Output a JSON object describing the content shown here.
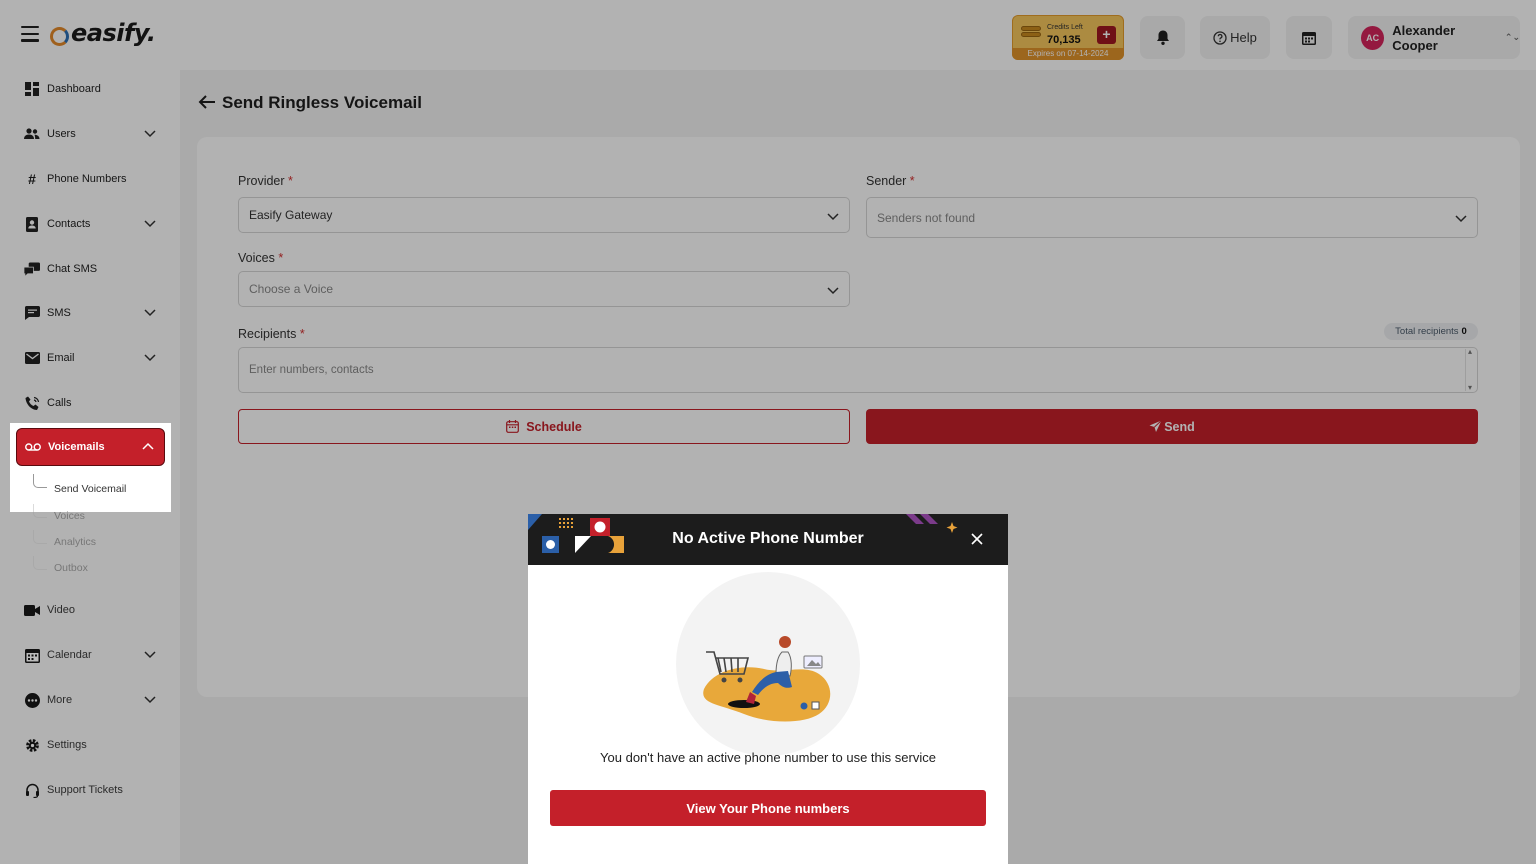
{
  "header": {
    "logo_text": "easify.",
    "credits": {
      "label": "Credits Left",
      "value": "70,135",
      "expires": "Expires on 07-14-2024",
      "plus": "+"
    },
    "help_label": "Help",
    "user": {
      "initials": "AC",
      "name": "Alexander Cooper",
      "caret": "⌃⌄"
    }
  },
  "sidebar": {
    "items": [
      {
        "label": "Dashboard",
        "icon": "dashboard-icon"
      },
      {
        "label": "Users",
        "icon": "users-icon"
      },
      {
        "label": "Phone Numbers",
        "icon": "hash-icon"
      },
      {
        "label": "Contacts",
        "icon": "contacts-icon"
      },
      {
        "label": "Chat SMS",
        "icon": "chat-icon"
      },
      {
        "label": "SMS",
        "icon": "sms-icon"
      },
      {
        "label": "Email",
        "icon": "mail-icon"
      },
      {
        "label": "Calls",
        "icon": "phone-icon"
      },
      {
        "label": "Voicemails",
        "icon": "voicemail-icon"
      },
      {
        "label": "Video",
        "icon": "video-icon"
      },
      {
        "label": "Calendar",
        "icon": "calendar-icon"
      },
      {
        "label": "More",
        "icon": "more-icon"
      },
      {
        "label": "Settings",
        "icon": "gear-icon"
      },
      {
        "label": "Support Tickets",
        "icon": "headset-icon"
      }
    ],
    "voicemail_sub": [
      "Send Voicemail",
      "Voices",
      "Analytics",
      "Outbox"
    ]
  },
  "page": {
    "title": "Send Ringless Voicemail",
    "provider_label": "Provider",
    "provider_value": "Easify Gateway",
    "sender_label": "Sender",
    "sender_placeholder": "Senders not found",
    "voices_label": "Voices",
    "voices_placeholder": "Choose a Voice",
    "recipients_label": "Recipients",
    "recipients_placeholder": "Enter numbers, contacts",
    "total_label": "Total recipients",
    "total_value": "0",
    "schedule_label": "Schedule",
    "send_label": "Send",
    "required_mark": "*"
  },
  "modal": {
    "title": "No Active Phone Number",
    "message": "You don't have an active phone number to use this service",
    "button": "View Your Phone numbers"
  },
  "colors": {
    "brand": "#c4202a",
    "modal_header": "#1c1c1c",
    "credits_bg": "#f6c75e"
  }
}
